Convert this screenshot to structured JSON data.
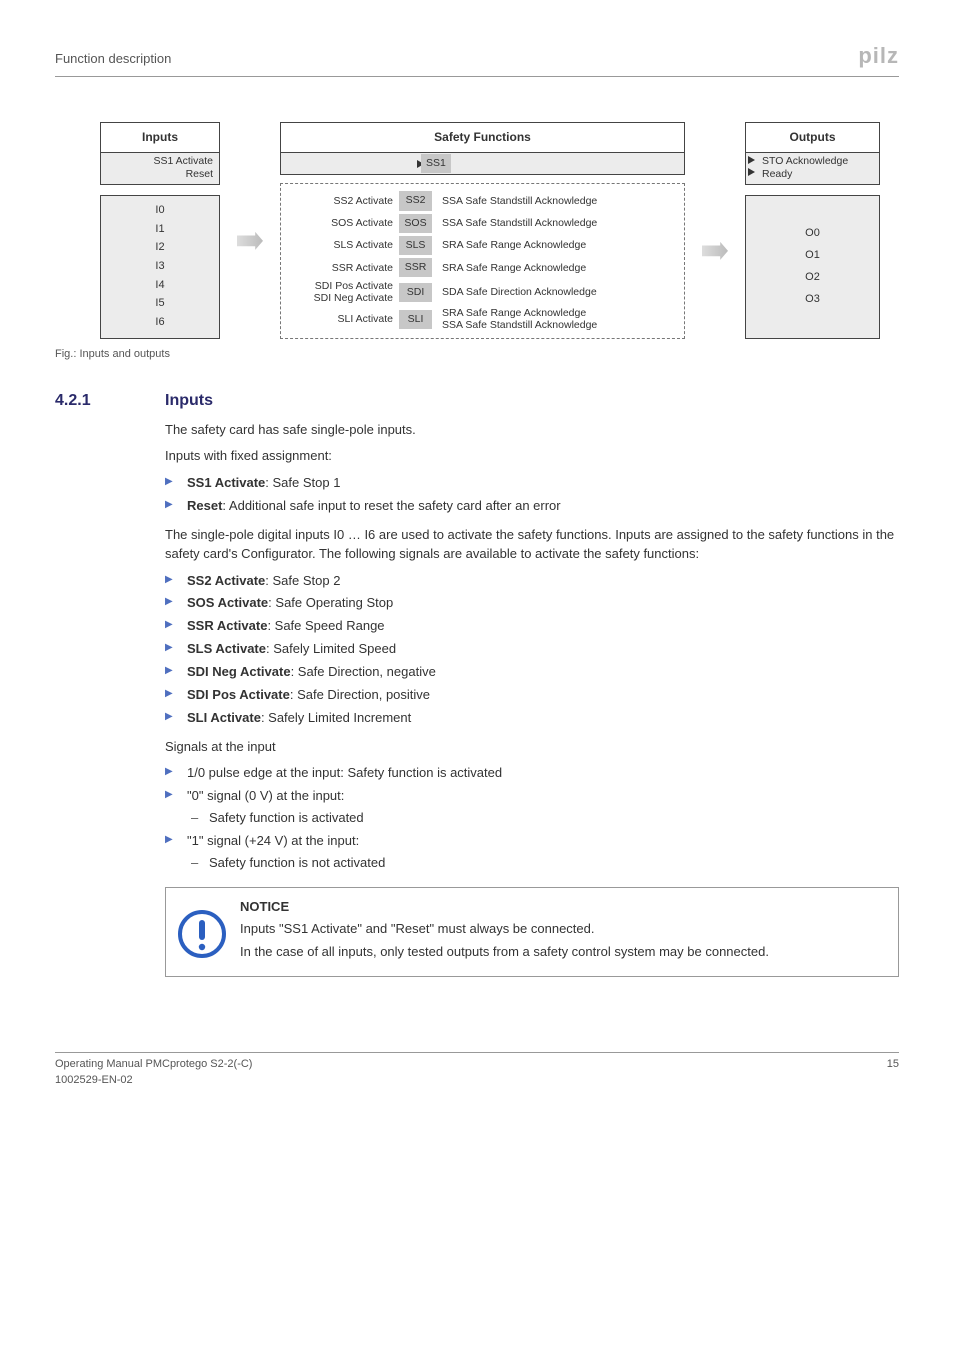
{
  "header": {
    "title": "Function description",
    "logo": "pilz"
  },
  "diagram": {
    "col_headers": {
      "inputs": "Inputs",
      "safety": "Safety Functions",
      "outputs": "Outputs"
    },
    "inputs_fixed": [
      "SS1 Activate",
      "Reset"
    ],
    "inputs_list": [
      "I0",
      "I1",
      "I2",
      "I3",
      "I4",
      "I5",
      "I6"
    ],
    "ss1_tag": "SS1",
    "safety_rows": [
      {
        "left": "SS2 Activate",
        "tag": "SS2",
        "ack": "SSA Safe Standstill Acknowledge"
      },
      {
        "left": "SOS Activate",
        "tag": "SOS",
        "ack": "SSA Safe Standstill Acknowledge"
      },
      {
        "left": "SLS Activate",
        "tag": "SLS",
        "ack": "SRA Safe Range Acknowledge"
      },
      {
        "left": "SSR Activate",
        "tag": "SSR",
        "ack": "SRA Safe Range Acknowledge"
      },
      {
        "left": "SDI Pos Activate\nSDI Neg Activate",
        "tag": "SDI",
        "ack": "SDA Safe Direction Acknowledge"
      },
      {
        "left": "SLI Activate",
        "tag": "SLI",
        "ack": "SRA Safe Range Acknowledge\nSSA Safe Standstill Acknowledge"
      }
    ],
    "outputs_fixed": [
      "STO Acknowledge",
      "Ready"
    ],
    "outputs_list": [
      "O0",
      "O1",
      "O2",
      "O3"
    ]
  },
  "fig_caption": "Fig.: Inputs and outputs",
  "section": {
    "num": "4.2.1",
    "title": "Inputs"
  },
  "body": {
    "p1": "The safety card has safe single-pole inputs.",
    "p2": "Inputs with fixed assignment:",
    "fixed_list": [
      {
        "b": "SS1 Activate",
        "t": ": Safe Stop 1"
      },
      {
        "b": "Reset",
        "t": ": Additional safe input to reset the safety card after an error"
      }
    ],
    "p3": "The single-pole digital inputs I0 … I6 are used to activate the safety functions. Inputs are assigned to the safety functions in the safety card's Configurator. The following signals are available to activate the safety functions:",
    "activate_list": [
      {
        "b": "SS2 Activate",
        "t": ": Safe Stop 2"
      },
      {
        "b": "SOS Activate",
        "t": ": Safe Operating Stop"
      },
      {
        "b": "SSR Activate",
        "t": ": Safe Speed Range"
      },
      {
        "b": "SLS Activate",
        "t": ": Safely Limited Speed"
      },
      {
        "b": "SDI Neg Activate",
        "t": ": Safe Direction, negative"
      },
      {
        "b": "SDI Pos Activate",
        "t": ": Safe Direction, positive"
      },
      {
        "b": "SLI Activate",
        "t": ": Safely Limited Increment"
      }
    ],
    "p4": "Signals at the input",
    "signal_list": {
      "s0": "1/0 pulse edge at the input: Safety function is activated",
      "s1": "\"0\" signal (0 V) at the input:",
      "s1a": "Safety function is activated",
      "s2": "\"1\" signal (+24 V) at the input:",
      "s2a": "Safety function is not activated"
    }
  },
  "notice": {
    "title": "NOTICE",
    "p1": "Inputs \"SS1 Activate\" and \"Reset\" must always be connected.",
    "p2": "In the case of all inputs, only tested outputs from a safety control system may be connected."
  },
  "footer": {
    "l1": "Operating Manual PMCprotego S2-2(-C)",
    "l2": "1002529-EN-02",
    "page": "15"
  }
}
